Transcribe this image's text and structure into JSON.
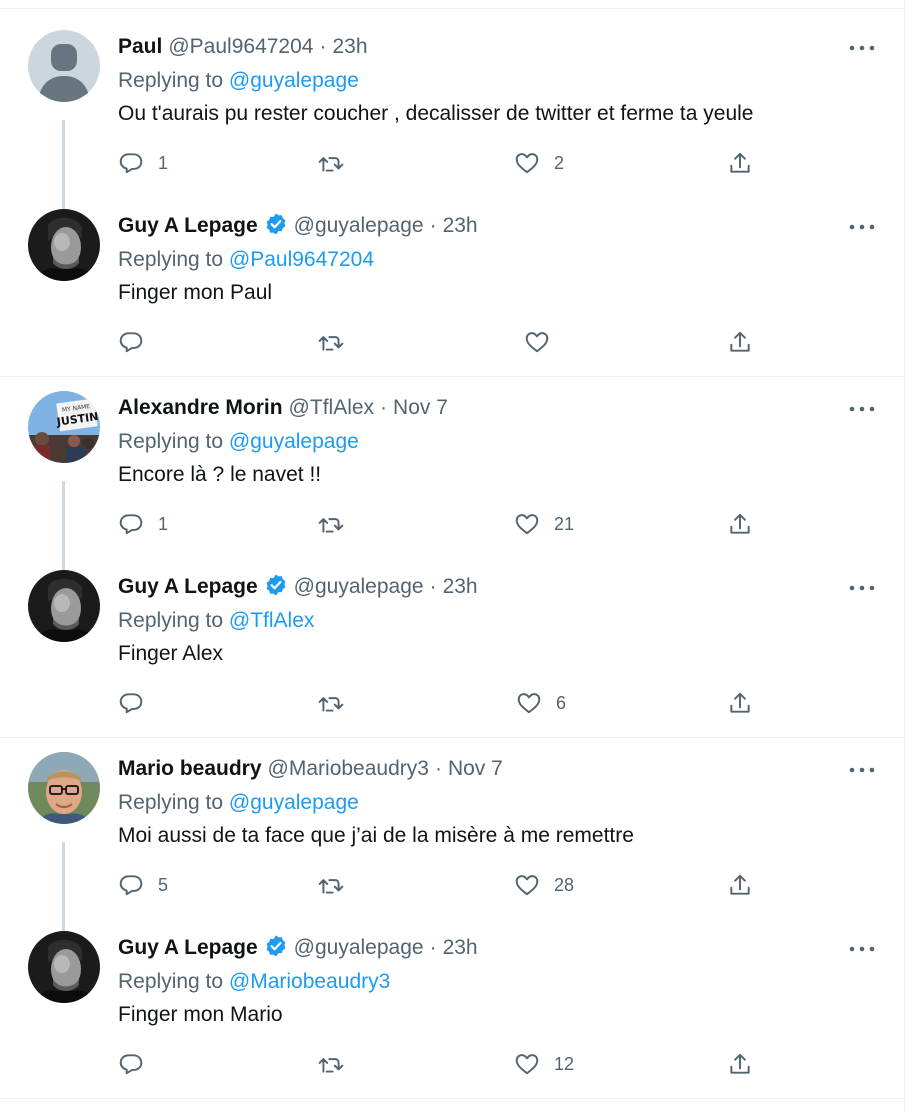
{
  "tweets": [
    {
      "name": "Paul",
      "handle": "@Paul9647204",
      "time": "23h",
      "replying_label": "Replying to",
      "replying_to": "@guyalepage",
      "text": "Ou t'aurais pu rester coucher , decalisser de twitter et ferme ta yeule",
      "verified": false,
      "replies": "1",
      "retweets": "",
      "likes": "2",
      "avatar": "default-avatar"
    },
    {
      "name": "Guy A Lepage",
      "handle": "@guyalepage",
      "time": "23h",
      "replying_label": "Replying to",
      "replying_to": "@Paul9647204",
      "text": "Finger mon Paul",
      "verified": true,
      "replies": "",
      "retweets": "",
      "likes": "",
      "avatar": "guy-avatar"
    },
    {
      "name": "Alexandre Morin",
      "handle": "@TflAlex",
      "time": "Nov 7",
      "replying_label": "Replying to",
      "replying_to": "@guyalepage",
      "text": "Encore là ?  le navet !!",
      "verified": false,
      "replies": "1",
      "retweets": "",
      "likes": "21",
      "avatar": "protest-sign-avatar"
    },
    {
      "name": "Guy A Lepage",
      "handle": "@guyalepage",
      "time": "23h",
      "replying_label": "Replying to",
      "replying_to": "@TflAlex",
      "text": "Finger Alex",
      "verified": true,
      "replies": "",
      "retweets": "",
      "likes": "6",
      "avatar": "guy-avatar"
    },
    {
      "name": "Mario beaudry",
      "handle": "@Mariobeaudry3",
      "time": "Nov 7",
      "replying_label": "Replying to",
      "replying_to": "@guyalepage",
      "text": "Moi aussi de ta face que j’ai de la misère à me remettre",
      "verified": false,
      "replies": "5",
      "retweets": "",
      "likes": "28",
      "avatar": "man-glasses-avatar"
    },
    {
      "name": "Guy A Lepage",
      "handle": "@guyalepage",
      "time": "23h",
      "replying_label": "Replying to",
      "replying_to": "@Mariobeaudry3",
      "text": "Finger mon Mario",
      "verified": true,
      "replies": "",
      "retweets": "",
      "likes": "12",
      "avatar": "guy-avatar"
    }
  ],
  "avatar_sign_text": "MY NAME JUSTIN",
  "dot": "·",
  "colors": {
    "text": "#0f1419",
    "secondary": "#536471",
    "link": "#1d9bf0",
    "verified": "#1d9bf0",
    "thread_line": "#cfd9de",
    "separator": "#eff3f4"
  },
  "icons": [
    "more-icon",
    "reply-icon",
    "retweet-icon",
    "like-icon",
    "share-icon",
    "verified-badge-icon"
  ]
}
